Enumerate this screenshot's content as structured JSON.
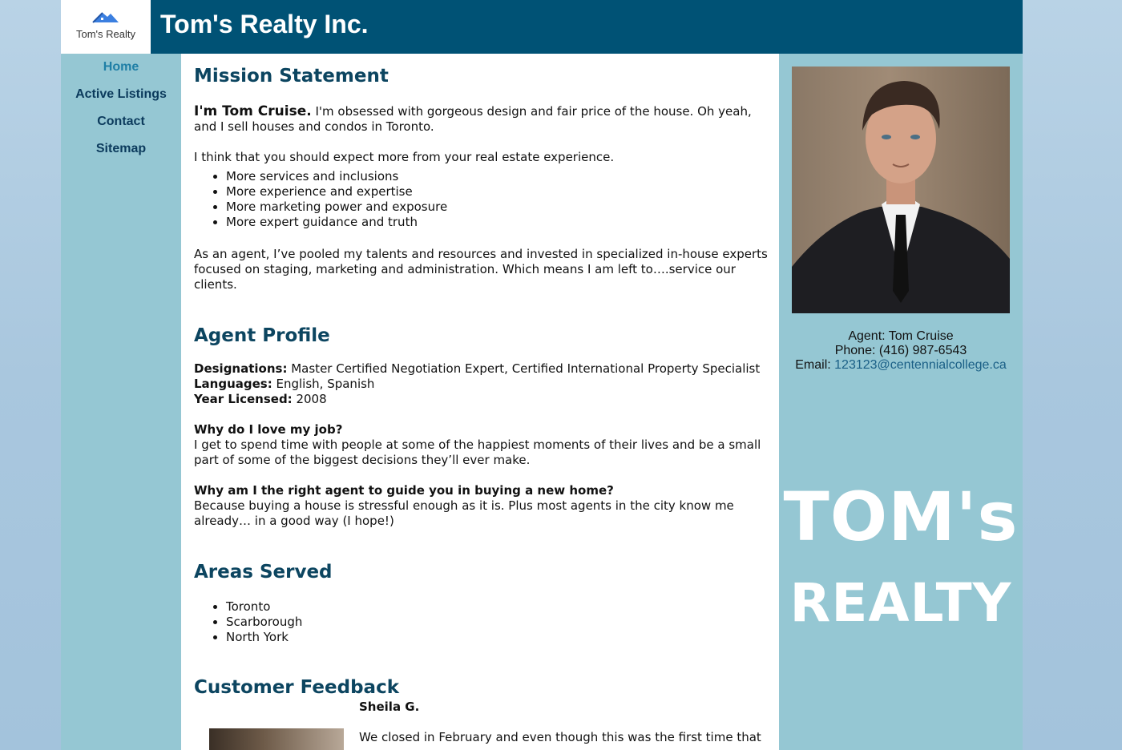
{
  "header": {
    "logo_text": "Tom's Realty",
    "site_title": "Tom's Realty Inc."
  },
  "nav": {
    "items": [
      {
        "label": "Home",
        "active": true
      },
      {
        "label": "Active Listings"
      },
      {
        "label": "Contact"
      },
      {
        "label": "Sitemap"
      }
    ]
  },
  "mission": {
    "heading": "Mission Statement",
    "intro_name": "I'm Tom Cruise.",
    "intro_text": " I'm obsessed with gorgeous design and fair price of the house. Oh yeah, and I sell houses and condos in Toronto.",
    "expect_text": "I think that you should expect more from your real estate experience.",
    "bullets": [
      "More services and inclusions",
      "More experience and expertise",
      "More marketing power and exposure",
      "More expert guidance and truth"
    ],
    "closing": "As an agent, I’ve pooled my talents and resources and invested in specialized in-house experts focused on staging, marketing and administration. Which means I am left to….service our clients."
  },
  "profile": {
    "heading": "Agent Profile",
    "designations_label": "Designations:",
    "designations_value": " Master Certified Negotiation Expert, Certified International Property Specialist",
    "languages_label": "Languages:",
    "languages_value": " English, Spanish",
    "year_label": "Year Licensed:",
    "year_value": " 2008",
    "q1": "Why do I love my job?",
    "a1": "I get to spend time with people at some of the happiest moments of their lives and be a small part of some of the biggest decisions they’ll ever make.",
    "q2": "Why am I the right agent to guide you in buying a new home?",
    "a2": "Because buying a house is stressful enough as it is. Plus most agents in the city know me already… in a good way (I hope!)"
  },
  "areas": {
    "heading": "Areas Served",
    "items": [
      "Toronto",
      "Scarborough",
      "North York"
    ]
  },
  "feedback": {
    "heading": "Customer Feedback",
    "name": "Sheila G.",
    "text": "We closed in February and even though this was the first time that"
  },
  "sidebar": {
    "agent_line": "Agent: Tom Cruise",
    "phone_line": "Phone: (416) 987-6543",
    "email_label": "Email: ",
    "email": "123123@centennialcollege.ca",
    "brand_line1": "TOM's",
    "brand_line2": "REALTY"
  },
  "colors": {
    "header_bg": "#005275",
    "nav_bg": "#95c7d3",
    "heading": "#0c4560",
    "link": "#1a5f86"
  }
}
